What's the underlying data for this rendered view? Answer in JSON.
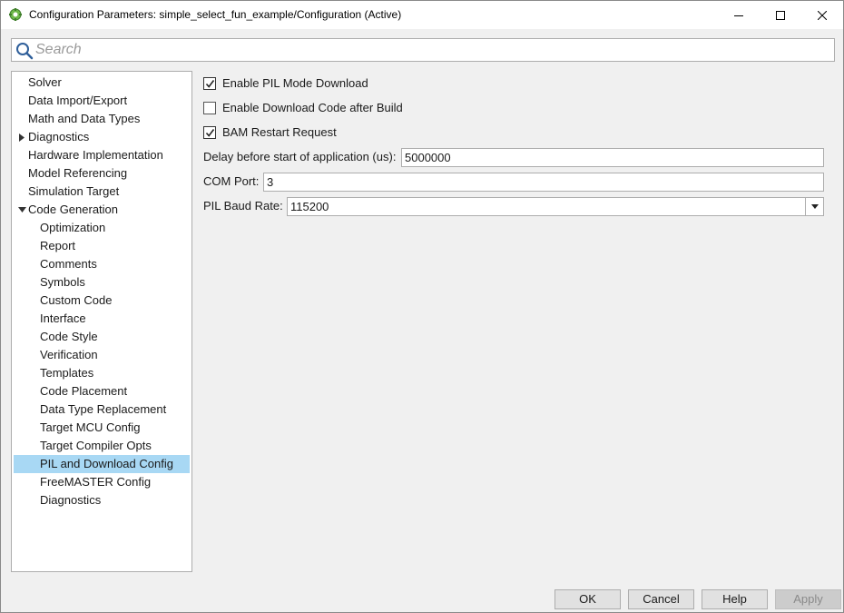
{
  "window": {
    "title": "Configuration Parameters: simple_select_fun_example/Configuration (Active)"
  },
  "search": {
    "placeholder": "Search"
  },
  "tree": {
    "items": [
      {
        "label": "Solver",
        "level": 0
      },
      {
        "label": "Data Import/Export",
        "level": 0
      },
      {
        "label": "Math and Data Types",
        "level": 0
      },
      {
        "label": "Diagnostics",
        "level": 0,
        "expander": "collapsed"
      },
      {
        "label": "Hardware Implementation",
        "level": 0
      },
      {
        "label": "Model Referencing",
        "level": 0
      },
      {
        "label": "Simulation Target",
        "level": 0
      },
      {
        "label": "Code Generation",
        "level": 0,
        "expander": "expanded"
      },
      {
        "label": "Optimization",
        "level": 1
      },
      {
        "label": "Report",
        "level": 1
      },
      {
        "label": "Comments",
        "level": 1
      },
      {
        "label": "Symbols",
        "level": 1
      },
      {
        "label": "Custom Code",
        "level": 1
      },
      {
        "label": "Interface",
        "level": 1
      },
      {
        "label": "Code Style",
        "level": 1
      },
      {
        "label": "Verification",
        "level": 1
      },
      {
        "label": "Templates",
        "level": 1
      },
      {
        "label": "Code Placement",
        "level": 1
      },
      {
        "label": "Data Type Replacement",
        "level": 1
      },
      {
        "label": "Target MCU Config",
        "level": 1
      },
      {
        "label": "Target Compiler Opts",
        "level": 1
      },
      {
        "label": "PIL and Download Config",
        "level": 1,
        "selected": true
      },
      {
        "label": "FreeMASTER Config",
        "level": 1
      },
      {
        "label": "Diagnostics",
        "level": 1
      }
    ],
    "selection_color": "#a8d8f4"
  },
  "panel": {
    "enable_pil": {
      "label": "Enable PIL Mode Download",
      "checked": true
    },
    "enable_download": {
      "label": "Enable Download Code after Build",
      "checked": false
    },
    "bam_restart": {
      "label": "BAM Restart Request",
      "checked": true
    },
    "delay": {
      "label": "Delay before start of application (us):",
      "value": "5000000"
    },
    "com_port": {
      "label": "COM Port:",
      "value": "3"
    },
    "baud_rate": {
      "label": "PIL Baud Rate:",
      "value": "115200"
    }
  },
  "buttons": {
    "ok": "OK",
    "cancel": "Cancel",
    "help": "Help",
    "apply": "Apply"
  },
  "icons": {
    "app": "simulink-config-icon",
    "search": "search-icon",
    "minimize": "minimize-icon",
    "maximize": "maximize-icon",
    "close": "close-icon"
  }
}
